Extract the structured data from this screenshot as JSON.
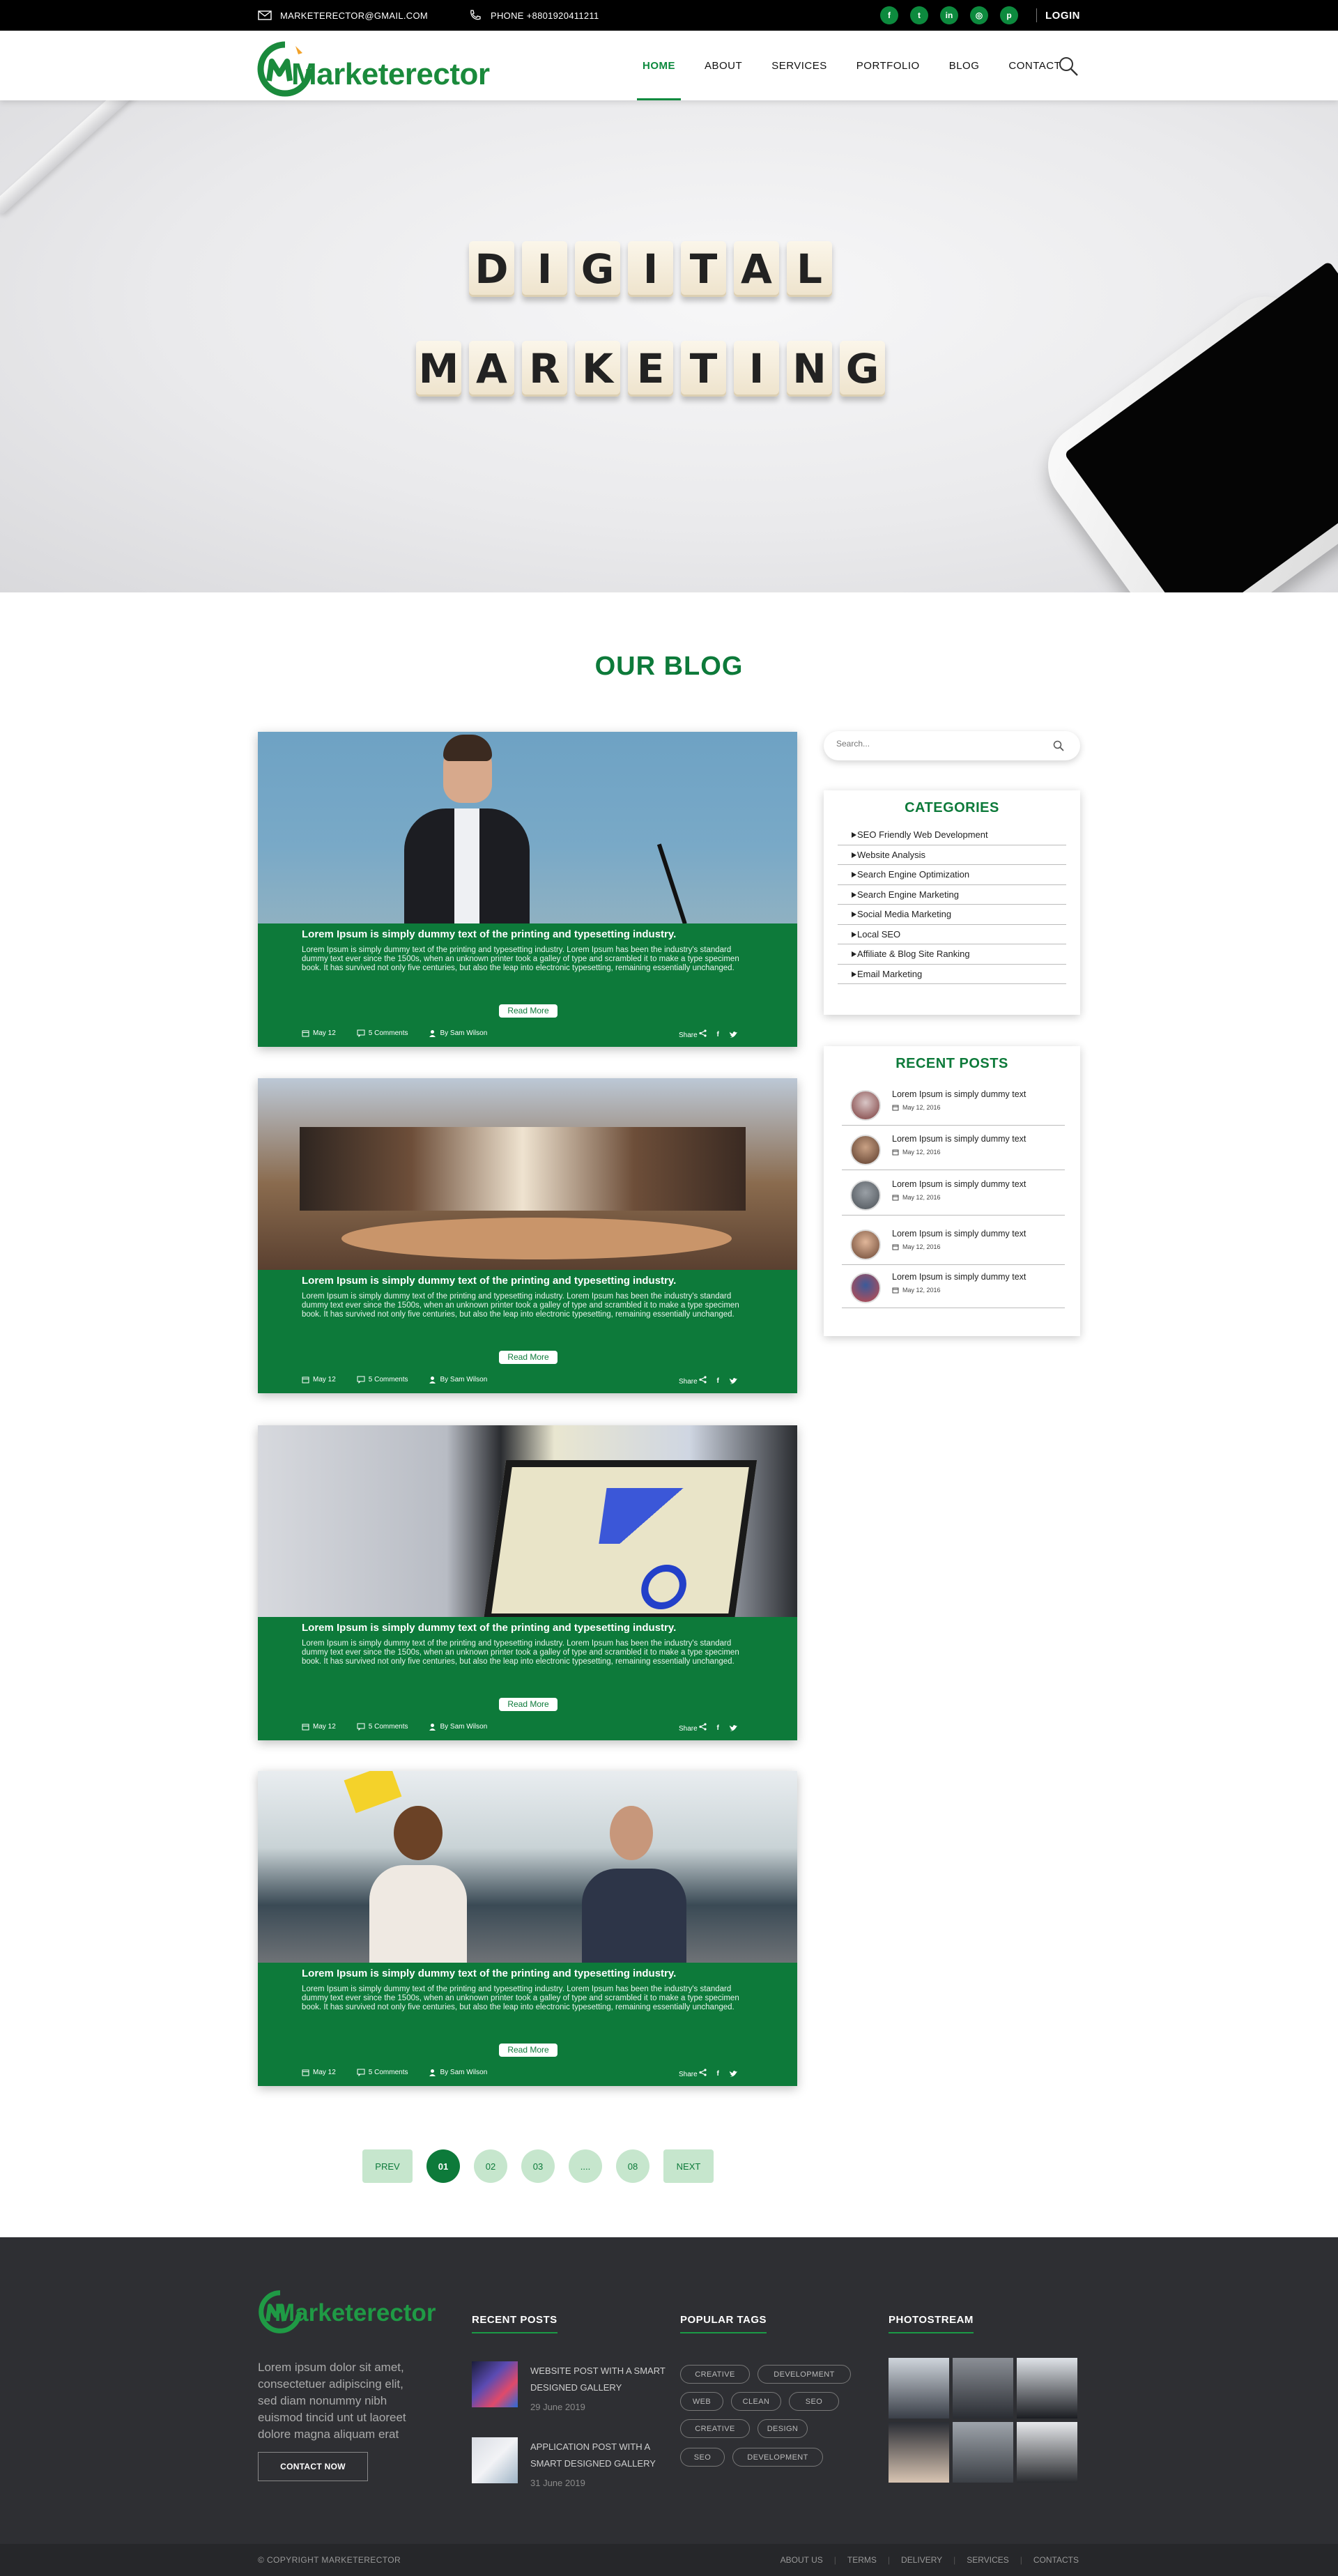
{
  "topbar": {
    "email": "MARKETERECTOR@GMAIL.COM",
    "phone": "PHONE +8801920411211",
    "socials": [
      "facebook-icon",
      "twitter-icon",
      "linkedin-icon",
      "instagram-icon",
      "pinterest-icon"
    ],
    "login": "LOGIN"
  },
  "brand": {
    "name": "Marketerector",
    "color": "#1a8a3c"
  },
  "nav": {
    "items": [
      "HOME",
      "ABOUT",
      "SERVICES",
      "PORTFOLIO",
      "BLOG",
      "CONTACT"
    ],
    "active": "HOME"
  },
  "hero": {
    "line1": [
      "D",
      "I",
      "G",
      "I",
      "T",
      "A",
      "L"
    ],
    "line2": [
      "M",
      "A",
      "R",
      "K",
      "E",
      "T",
      "I",
      "N",
      "G"
    ],
    "slides": 3,
    "active_slide": 1
  },
  "blog": {
    "title": "OUR BLOG",
    "posts": [
      {
        "title": "Lorem Ipsum is simply dummy text of the printing and typesetting industry.",
        "excerpt": "Lorem Ipsum is simply dummy text of the printing and typesetting industry. Lorem Ipsum has been the industry's standard dummy text ever since the 1500s, when an unknown printer took a galley of type and scrambled it to make a type specimen book. It has survived not only five centuries, but also the leap into electronic typesetting, remaining essentially unchanged.",
        "read_more": "Read More",
        "date": "May 12",
        "comments": "5 Comments",
        "author": "By Sam Wilson",
        "share": "Share"
      },
      {
        "title": "Lorem Ipsum is simply dummy text of the printing and typesetting industry.",
        "excerpt": "Lorem Ipsum is simply dummy text of the printing and typesetting industry. Lorem Ipsum has been the industry's standard dummy text ever since the 1500s, when an unknown printer took a galley of type and scrambled it to make a type specimen book. It has survived not only five centuries, but also the leap into electronic typesetting, remaining essentially unchanged.",
        "read_more": "Read More",
        "date": "May 12",
        "comments": "5 Comments",
        "author": "By Sam Wilson",
        "share": "Share"
      },
      {
        "title": "Lorem Ipsum is simply dummy text of the printing and typesetting industry.",
        "excerpt": "Lorem Ipsum is simply dummy text of the printing and typesetting industry. Lorem Ipsum has been the industry's standard dummy text ever since the 1500s, when an unknown printer took a galley of type and scrambled it to make a type specimen book. It has survived not only five centuries, but also the leap into electronic typesetting, remaining essentially unchanged.",
        "read_more": "Read More",
        "date": "May 12",
        "comments": "5 Comments",
        "author": "By Sam Wilson",
        "share": "Share"
      },
      {
        "title": "Lorem Ipsum is simply dummy text of the printing and typesetting industry.",
        "excerpt": "Lorem Ipsum is simply dummy text of the printing and typesetting industry. Lorem Ipsum has been the industry's standard dummy text ever since the 1500s, when an unknown printer took a galley of type and scrambled it to make a type specimen book. It has survived not only five centuries, but also the leap into electronic typesetting, remaining essentially unchanged.",
        "read_more": "Read More",
        "date": "May 12",
        "comments": "5 Comments",
        "author": "By Sam Wilson",
        "share": "Share"
      }
    ]
  },
  "sidebar": {
    "search_placeholder": "Search...",
    "categories_title": "CATEGORIES",
    "categories": [
      "SEO Friendly Web Development",
      "Website Analysis",
      "Search Engine Optimization",
      "Search Engine Marketing",
      "Social Media Marketing",
      "Local SEO",
      "Affiliate & Blog Site Ranking",
      "Email Marketing"
    ],
    "recent_title": "RECENT POSTS",
    "recent_posts": [
      {
        "title": "Lorem Ipsum is simply dummy text",
        "date": "May 12, 2016"
      },
      {
        "title": "Lorem Ipsum is simply dummy text",
        "date": "May 12, 2016"
      },
      {
        "title": "Lorem Ipsum is simply dummy text",
        "date": "May 12, 2016"
      },
      {
        "title": "Lorem Ipsum is simply dummy text",
        "date": "May 12, 2016"
      },
      {
        "title": "Lorem Ipsum is simply dummy text",
        "date": "May 12, 2016"
      }
    ]
  },
  "pagination": {
    "prev": "PREV",
    "pages": [
      "01",
      "02",
      "03",
      "....",
      "08"
    ],
    "active": "01",
    "next": "NEXT"
  },
  "footer": {
    "brand": "Marketerector",
    "about": "Lorem ipsum dolor sit amet, consectetuer adipiscing elit, sed diam nonummy nibh euismod tincid  unt ut laoreet dolore magna aliquam erat",
    "contact_button": "CONTACT NOW",
    "recent_title": "RECENT POSTS",
    "recent_posts": [
      {
        "title": "WEBSITE POST WITH A SMART DESIGNED GALLERY",
        "date": "29 June 2019"
      },
      {
        "title": "APPLICATION POST WITH A SMART DESIGNED GALLERY",
        "date": "31 June 2019"
      }
    ],
    "tags_title": "POPULAR TAGS",
    "tags": [
      "CREATIVE",
      "DEVELOPMENT",
      "WEB",
      "CLEAN",
      "SEO",
      "CREATIVE",
      "DESIGN",
      "SEO",
      "DEVELOPMENT"
    ],
    "photostream_title": "PHOTOSTREAM",
    "copyright": "© COPYRIGHT MARKETERECTOR",
    "links": [
      "ABOUT US",
      "TERMS",
      "DELIVERY",
      "SERVICES",
      "CONTACTS"
    ]
  },
  "colors": {
    "accent": "#0d7a3a",
    "footer_bg": "#2e2f33",
    "topbar_bg": "#000000"
  }
}
